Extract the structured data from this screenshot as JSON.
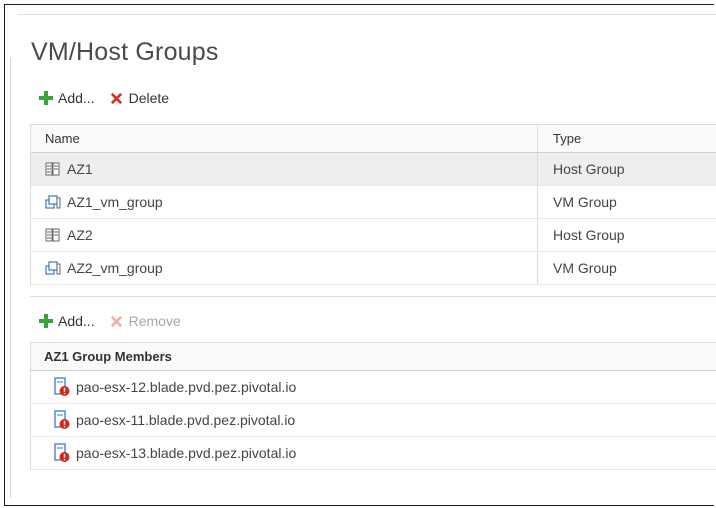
{
  "page": {
    "title": "VM/Host Groups"
  },
  "groups_toolbar": {
    "add_label": "Add...",
    "delete_label": "Delete"
  },
  "groups_table": {
    "columns": {
      "name": "Name",
      "type": "Type"
    },
    "rows": [
      {
        "name": "AZ1",
        "type": "Host Group",
        "icon": "host-group-icon",
        "selected": true
      },
      {
        "name": "AZ1_vm_group",
        "type": "VM Group",
        "icon": "vm-group-icon",
        "selected": false
      },
      {
        "name": "AZ2",
        "type": "Host Group",
        "icon": "host-group-icon",
        "selected": false
      },
      {
        "name": "AZ2_vm_group",
        "type": "VM Group",
        "icon": "vm-group-icon",
        "selected": false
      }
    ]
  },
  "members_toolbar": {
    "add_label": "Add...",
    "remove_label": "Remove"
  },
  "members_table": {
    "header": "AZ1 Group Members",
    "rows": [
      {
        "name": "pao-esx-12.blade.pvd.pez.pivotal.io",
        "icon": "host-error-icon"
      },
      {
        "name": "pao-esx-11.blade.pvd.pez.pivotal.io",
        "icon": "host-error-icon"
      },
      {
        "name": "pao-esx-13.blade.pvd.pez.pivotal.io",
        "icon": "host-error-icon"
      }
    ]
  },
  "colors": {
    "add_green": "#3aa33a",
    "delete_red": "#d93025",
    "disabled": "#a8a8a8",
    "selected_row": "#eeeeee",
    "error_red": "#d9261c"
  }
}
